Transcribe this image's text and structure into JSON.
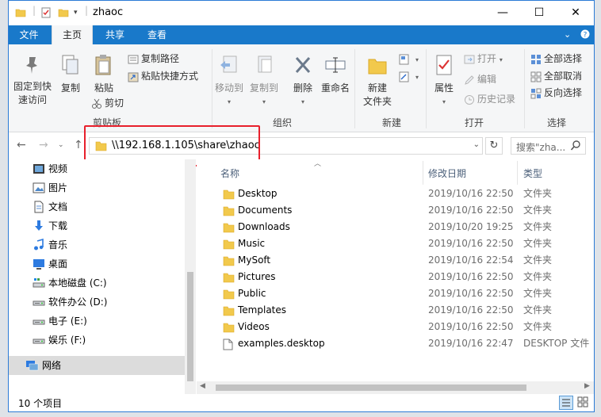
{
  "window": {
    "title": "zhaoc"
  },
  "window_controls": {
    "minimize": "—",
    "maximize": "☐",
    "close": "✕"
  },
  "tabs": [
    {
      "label": "文件",
      "active": false
    },
    {
      "label": "主页",
      "active": true
    },
    {
      "label": "共享",
      "active": false
    },
    {
      "label": "查看",
      "active": false
    }
  ],
  "ribbon": {
    "clipboard": {
      "group_label": "剪贴板",
      "pin_line1": "固定到快",
      "pin_line2": "速访问",
      "copy": "复制",
      "paste": "粘贴",
      "copy_path": "复制路径",
      "paste_shortcut": "粘贴快捷方式",
      "cut": "剪切"
    },
    "organize": {
      "group_label": "组织",
      "move_to": "移动到",
      "copy_to": "复制到",
      "delete": "删除",
      "rename": "重命名"
    },
    "new": {
      "group_label": "新建",
      "new_folder_line1": "新建",
      "new_folder_line2": "文件夹"
    },
    "open": {
      "group_label": "打开",
      "properties": "属性",
      "open": "打开",
      "edit": "编辑",
      "history": "历史记录"
    },
    "select": {
      "group_label": "选择",
      "select_all": "全部选择",
      "select_none": "全部取消",
      "invert": "反向选择"
    }
  },
  "address": {
    "path": "\\\\192.168.1.105\\share\\zhaoc",
    "search_placeholder": "搜索\"zha..."
  },
  "nav_items": [
    {
      "label": "视频",
      "icon": "video-icon"
    },
    {
      "label": "图片",
      "icon": "pictures-icon"
    },
    {
      "label": "文档",
      "icon": "documents-icon"
    },
    {
      "label": "下载",
      "icon": "download-icon"
    },
    {
      "label": "音乐",
      "icon": "music-icon"
    },
    {
      "label": "桌面",
      "icon": "desktop-icon"
    },
    {
      "label": "本地磁盘 (C:)",
      "icon": "local-disk-icon"
    },
    {
      "label": "软件办公 (D:)",
      "icon": "drive-icon"
    },
    {
      "label": "电子 (E:)",
      "icon": "drive-icon"
    },
    {
      "label": "娱乐 (F:)",
      "icon": "drive-icon"
    },
    {
      "label": "网络",
      "icon": "network-icon",
      "selected": true
    }
  ],
  "columns": {
    "name": "名称",
    "date": "修改日期",
    "type": "类型"
  },
  "files": [
    {
      "name": "Desktop",
      "date": "2019/10/16 22:50",
      "type": "文件夹",
      "icon": "folder-icon"
    },
    {
      "name": "Documents",
      "date": "2019/10/16 22:50",
      "type": "文件夹",
      "icon": "folder-icon"
    },
    {
      "name": "Downloads",
      "date": "2019/10/20 19:25",
      "type": "文件夹",
      "icon": "folder-icon"
    },
    {
      "name": "Music",
      "date": "2019/10/16 22:50",
      "type": "文件夹",
      "icon": "folder-icon"
    },
    {
      "name": "MySoft",
      "date": "2019/10/16 22:54",
      "type": "文件夹",
      "icon": "folder-icon"
    },
    {
      "name": "Pictures",
      "date": "2019/10/16 22:50",
      "type": "文件夹",
      "icon": "folder-icon"
    },
    {
      "name": "Public",
      "date": "2019/10/16 22:50",
      "type": "文件夹",
      "icon": "folder-icon"
    },
    {
      "name": "Templates",
      "date": "2019/10/16 22:50",
      "type": "文件夹",
      "icon": "folder-icon"
    },
    {
      "name": "Videos",
      "date": "2019/10/16 22:50",
      "type": "文件夹",
      "icon": "folder-icon"
    },
    {
      "name": "examples.desktop",
      "date": "2019/10/16 22:47",
      "type": "DESKTOP 文件",
      "icon": "file-icon"
    }
  ],
  "status": {
    "item_count": "10 个项目"
  },
  "colors": {
    "accent": "#1979ca",
    "highlight": "#e8202c",
    "folder": "#f2c94c"
  }
}
